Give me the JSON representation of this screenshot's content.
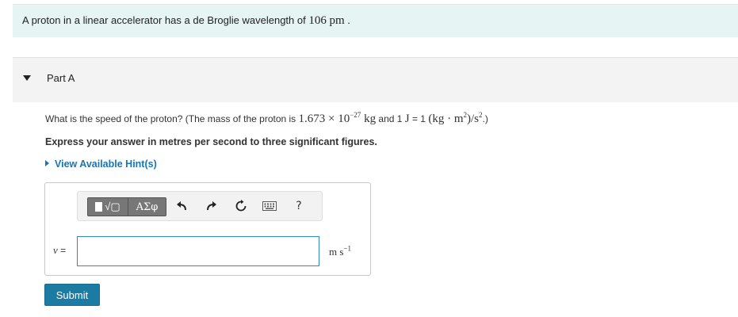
{
  "problem": {
    "text_before": "A proton in a linear accelerator has a de Broglie wavelength of",
    "wavelength": "106",
    "wavelength_unit": "pm",
    "text_after": "."
  },
  "part": {
    "title": "Part A"
  },
  "question": {
    "text_1": "What is the speed of the proton? (The mass of the proton is",
    "mass_coef": "1.673",
    "times": "×",
    "mass_base": "10",
    "mass_exp": "−27",
    "mass_unit": "kg",
    "text_2": "and 1",
    "joule": "J",
    "eq": "= 1",
    "def_open": "(kg · m",
    "def_exp1": "2",
    "def_close": ")/s",
    "def_exp2": "2",
    "text_3": ".)"
  },
  "instruction": "Express your answer in metres per second to three significant figures.",
  "hint_link": "View Available Hint(s)",
  "toolbar": {
    "template_label": "√▢",
    "greek_label": "ΑΣφ",
    "undo_icon": "undo-arrow-icon",
    "redo_icon": "redo-arrow-icon",
    "reset_icon": "reset-icon",
    "keyboard_icon": "keyboard-icon",
    "help_label": "?"
  },
  "answer": {
    "variable": "v",
    "equals": "=",
    "value": "",
    "unit_base": "m s",
    "unit_exp": "−1"
  },
  "submit_label": "Submit",
  "colors": {
    "problem_bg": "#e6f4f4",
    "link": "#1a74b5",
    "submit_bg": "#1c7ba3",
    "input_border": "#2c8cb7"
  }
}
